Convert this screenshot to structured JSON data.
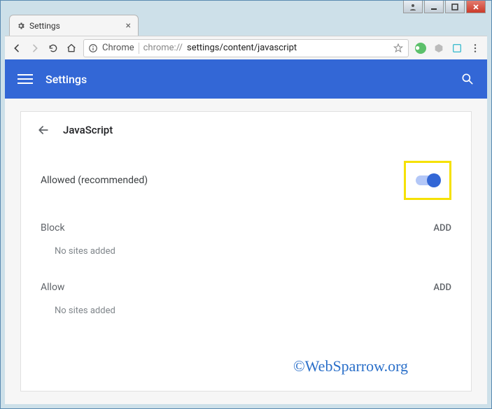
{
  "window": {
    "tab_title": "Settings",
    "omnibox_prefix": "Chrome",
    "url_grey": "chrome://",
    "url_dark": "settings/content/javascript"
  },
  "header": {
    "title": "Settings"
  },
  "page": {
    "subheading": "JavaScript",
    "toggle_label": "Allowed (recommended)",
    "toggle_on": true,
    "sections": {
      "block": {
        "title": "Block",
        "add_label": "ADD",
        "empty_text": "No sites added"
      },
      "allow": {
        "title": "Allow",
        "add_label": "ADD",
        "empty_text": "No sites added"
      }
    }
  },
  "watermark": "©WebSparrow.org"
}
